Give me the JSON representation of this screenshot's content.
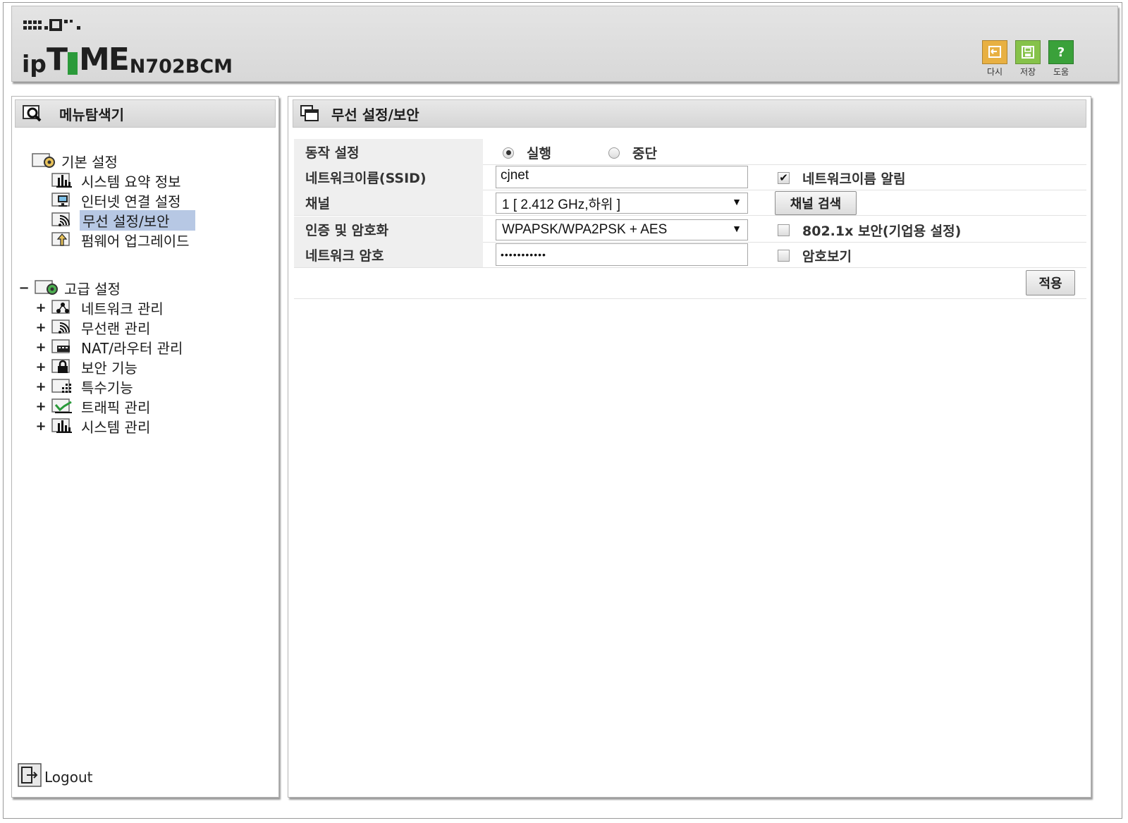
{
  "header": {
    "brand_ip": "ip",
    "brand_t": "T",
    "brand_me": "ME",
    "model": "N702BCM",
    "buttons": [
      {
        "label": "다시",
        "icon": "undo-icon",
        "color": "#e8b042"
      },
      {
        "label": "저장",
        "icon": "save-icon",
        "color": "#86c24a"
      },
      {
        "label": "도움",
        "icon": "help-icon",
        "color": "#3aa13a"
      }
    ]
  },
  "sidebar": {
    "title": "메뉴탐색기",
    "basic": {
      "label": "기본 설정",
      "items": [
        {
          "label": "시스템 요약 정보",
          "icon": "chart-icon"
        },
        {
          "label": "인터넷 연결 설정",
          "icon": "monitor-icon"
        },
        {
          "label": "무선 설정/보안",
          "icon": "wireless-icon",
          "selected": true
        },
        {
          "label": "펌웨어 업그레이드",
          "icon": "upgrade-icon"
        }
      ]
    },
    "advanced": {
      "label": "고급 설정",
      "toggle": "−",
      "items": [
        {
          "label": "네트워크 관리",
          "icon": "network-icon",
          "toggle": "+"
        },
        {
          "label": "무선랜 관리",
          "icon": "wireless-icon",
          "toggle": "+"
        },
        {
          "label": "NAT/라우터 관리",
          "icon": "router-icon",
          "toggle": "+"
        },
        {
          "label": "보안 기능",
          "icon": "lock-icon",
          "toggle": "+"
        },
        {
          "label": "특수기능",
          "icon": "special-icon",
          "toggle": "+"
        },
        {
          "label": "트래픽 관리",
          "icon": "traffic-icon",
          "toggle": "+"
        },
        {
          "label": "시스템 관리",
          "icon": "chart-icon",
          "toggle": "+"
        }
      ]
    },
    "logout": "Logout"
  },
  "main": {
    "title": "무선 설정/보안",
    "rows": {
      "operation": {
        "label": "동작 설정",
        "run": "실행",
        "stop": "중단",
        "selected": "실행"
      },
      "ssid": {
        "label": "네트워크이름(SSID)",
        "value": "cjnet",
        "broadcast_label": "네트워크이름 알림",
        "broadcast_checked": true
      },
      "channel": {
        "label": "채널",
        "value": "1 [ 2.412 GHz,하위 ]",
        "scan_button": "채널 검색"
      },
      "auth": {
        "label": "인증 및 암호화",
        "value": "WPAPSK/WPA2PSK + AES",
        "enterprise_label": "802.1x 보안(기업용 설정)",
        "enterprise_checked": false
      },
      "password": {
        "label": "네트워크 암호",
        "value": "•••••••••••",
        "show_label": "암호보기",
        "show_checked": false
      }
    },
    "apply_button": "적용"
  }
}
